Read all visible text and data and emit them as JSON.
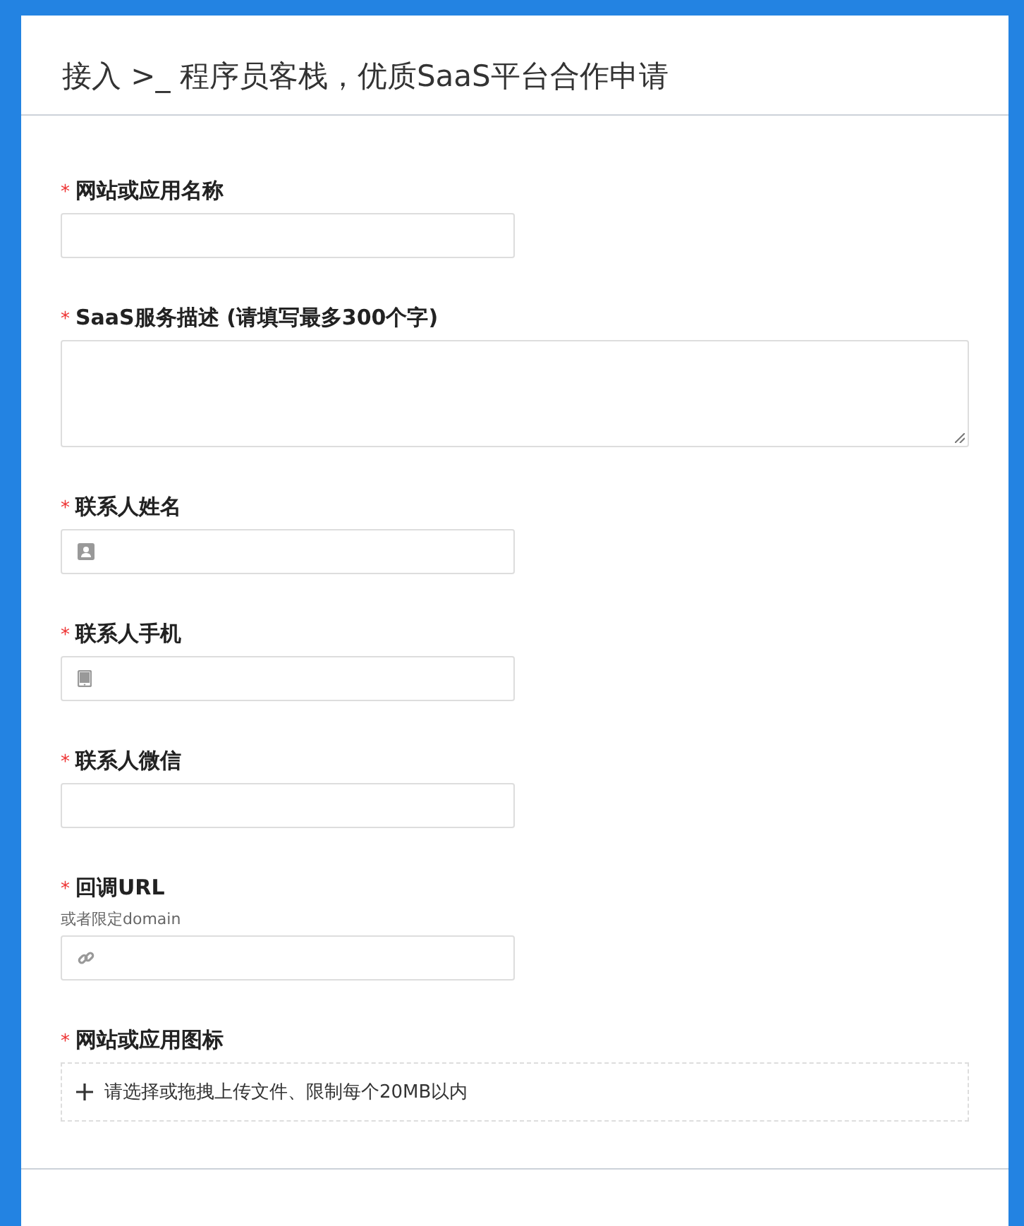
{
  "title": "接入 >_ 程序员客栈，优质SaaS平台合作申请",
  "fields": [
    {
      "kind": "text",
      "marker": "*",
      "label": "网站或应用名称"
    },
    {
      "kind": "textarea",
      "marker": "*",
      "label": "SaaS服务描述 (请填写最多300个字)"
    },
    {
      "kind": "person",
      "marker": "*",
      "label": "联系人姓名"
    },
    {
      "kind": "phone",
      "marker": "*",
      "label": "联系人手机"
    },
    {
      "kind": "text",
      "marker": "*",
      "label": "联系人微信"
    },
    {
      "kind": "link",
      "marker": "*",
      "label": "回调URL",
      "hint": "或者限定domain"
    },
    {
      "kind": "upload",
      "marker": "*",
      "label": "网站或应用图标",
      "placeholder": "请选择或拖拽上传文件、限制每个20MB以内"
    }
  ]
}
